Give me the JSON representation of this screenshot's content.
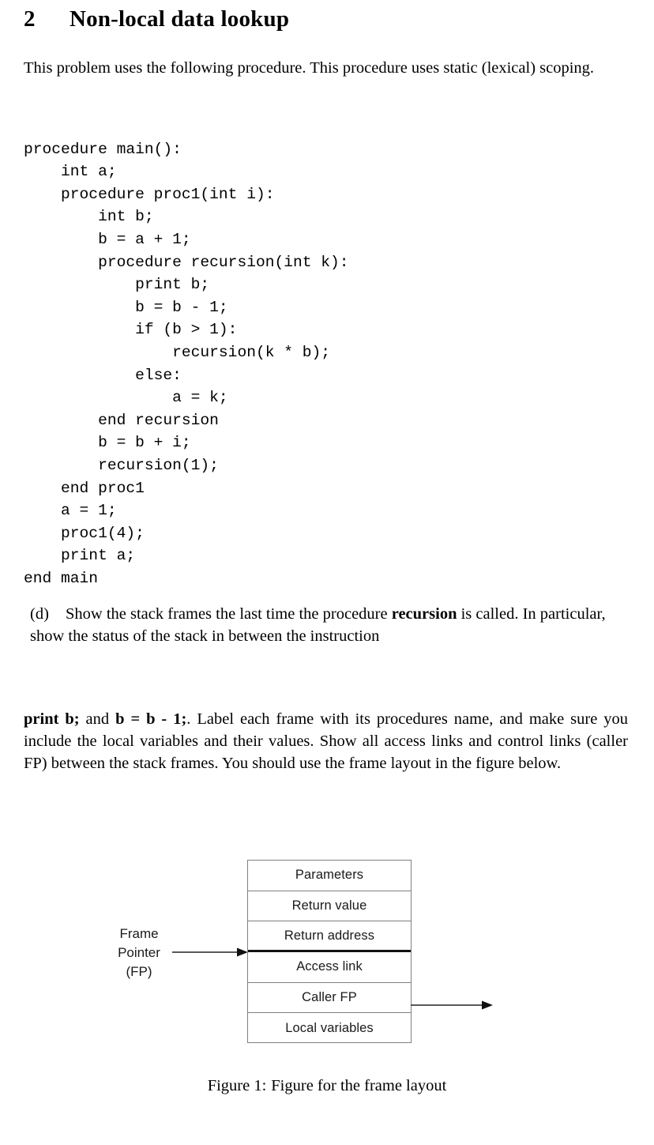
{
  "document": {
    "section": {
      "number": "2",
      "title": "Non-local data lookup"
    },
    "intro_paragraph": "This problem uses the following procedure. This procedure uses static (lexical) scoping.",
    "code_listing": "procedure main():\n    int a;\n    procedure proc1(int i):\n        int b;\n        b = a + 1;\n        procedure recursion(int k):\n            print b;\n            b = b - 1;\n            if (b > 1):\n                recursion(k * b);\n            else:\n                a = k;\n        end recursion\n        b = b + i;\n        recursion(1);\n    end proc1\n    a = 1;\n    proc1(4);\n    print a;\nend main",
    "question": {
      "marker": "(d)",
      "text_part1": "Show the stack frames the last time the procedure ",
      "bold_term": "recursion",
      "text_part2": " is called. In particular, show the status of the stack in between the instruction"
    },
    "continuation": {
      "bold_a": "print b;",
      "mid_a": " and ",
      "bold_b": "b = b - 1;",
      "rest": ". Label each frame with its procedures name, and make sure you include the local variables and their values. Show all access links and control links (caller FP) between the stack frames. You should use the frame layout in the figure below."
    },
    "figure": {
      "frame_rows": [
        "Parameters",
        "Return value",
        "Return address",
        "Access link",
        "Caller FP",
        "Local variables"
      ],
      "thick_divider_after_row_index": 2,
      "fp_label_lines": [
        "Frame",
        "Pointer",
        "(FP)"
      ],
      "caption_number": "Figure 1:",
      "caption_text": "Figure for the frame layout",
      "colors": {
        "box_border": "#808080",
        "thick_divider": "#111111",
        "arrow": "#222222",
        "diagram_text": "#1a1a1a"
      }
    }
  }
}
